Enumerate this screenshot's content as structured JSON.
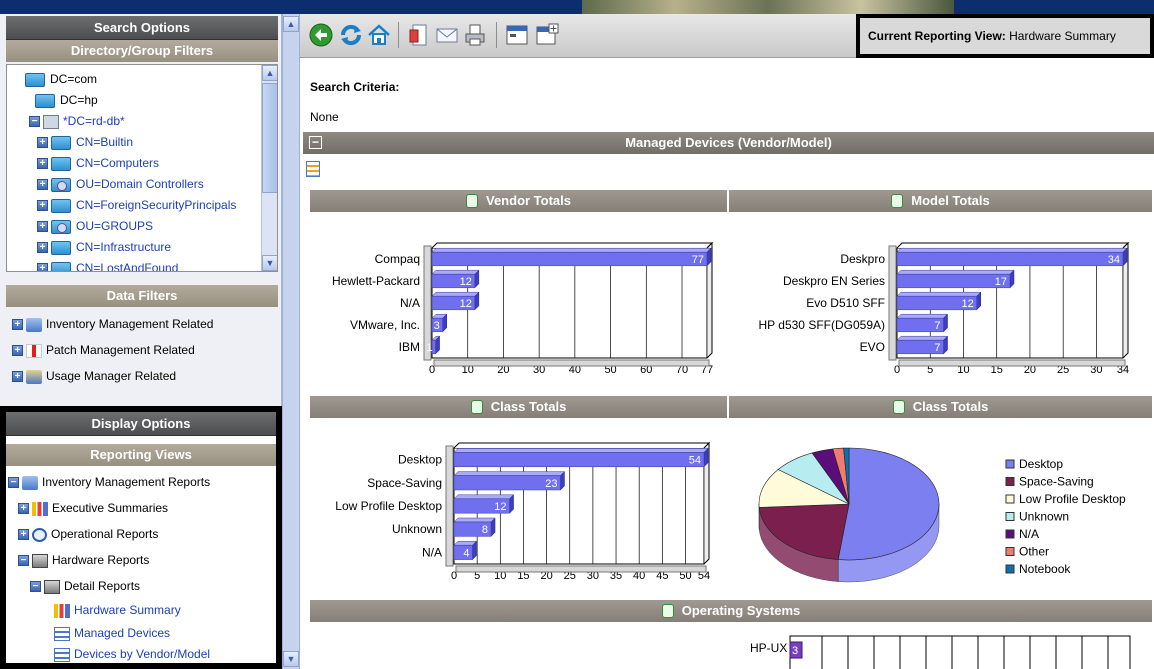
{
  "left": {
    "search_options": "Search Options",
    "directory_filters": "Directory/Group Filters",
    "tree": [
      {
        "label": "DC=com",
        "level": 0
      },
      {
        "label": "DC=hp",
        "level": 1
      },
      {
        "label": "*DC=rd-db*",
        "level": 1
      },
      {
        "label": "CN=Builtin",
        "level": 2
      },
      {
        "label": "CN=Computers",
        "level": 2
      },
      {
        "label": "OU=Domain Controllers",
        "level": 2
      },
      {
        "label": "CN=ForeignSecurityPrincipals",
        "level": 2
      },
      {
        "label": "OU=GROUPS",
        "level": 2
      },
      {
        "label": "CN=Infrastructure",
        "level": 2
      },
      {
        "label": "CN=LostAndFound",
        "level": 2
      }
    ],
    "data_filters": "Data Filters",
    "filters": [
      "Inventory Management Related",
      "Patch Management Related",
      "Usage Manager Related"
    ],
    "display_options": "Display Options",
    "reporting_views": "Reporting Views",
    "views": [
      "Inventory Management Reports",
      "Executive Summaries",
      "Operational Reports",
      "Hardware Reports",
      "Detail Reports",
      "Hardware Summary",
      "Managed Devices",
      "Devices by Vendor/Model"
    ]
  },
  "toolbar": {
    "icons": [
      "back-icon",
      "refresh-icon",
      "home-icon",
      "export-icon",
      "email-icon",
      "print-icon",
      "window-icon",
      "new-window-icon"
    ],
    "current_view_label": "Current Reporting View:",
    "current_view_value": "Hardware Summary"
  },
  "main": {
    "search_criteria_label": "Search Criteria:",
    "search_criteria_value": "None",
    "section_title": "Managed Devices (Vendor/Model)",
    "collapse_symbol": "−",
    "os_title": "Operating Systems",
    "os_partial_label": "HP-UX",
    "os_partial_value": "3"
  },
  "colors": {
    "bar": "#6f6ff0",
    "legend": [
      "#7b7ff0",
      "#7a1f4e",
      "#fffbd9",
      "#b7ecf0",
      "#5b0d79",
      "#f07c6f",
      "#0f6fae"
    ]
  },
  "chart_data": [
    {
      "type": "bar",
      "title": "Vendor Totals",
      "categories": [
        "Compaq",
        "Hewlett-Packard",
        "N/A",
        "VMware, Inc.",
        "IBM"
      ],
      "values": [
        77,
        12,
        12,
        3,
        1
      ],
      "xticks": [
        "0",
        "10",
        "20",
        "30",
        "40",
        "50",
        "60",
        "70",
        "77"
      ],
      "xlim": [
        0,
        77
      ]
    },
    {
      "type": "bar",
      "title": "Model Totals",
      "categories": [
        "Deskpro",
        "Deskpro EN Series",
        "Evo D510 SFF",
        "HP d530 SFF(DG059A)",
        "EVO"
      ],
      "values": [
        34,
        17,
        12,
        7,
        7
      ],
      "xticks": [
        "0",
        "5",
        "10",
        "15",
        "20",
        "25",
        "30",
        "34"
      ],
      "xlim": [
        0,
        34
      ]
    },
    {
      "type": "bar",
      "title": "Class Totals",
      "categories": [
        "Desktop",
        "Space-Saving",
        "Low Profile Desktop",
        "Unknown",
        "N/A"
      ],
      "values": [
        54,
        23,
        12,
        8,
        4
      ],
      "xticks": [
        "0",
        "5",
        "10",
        "15",
        "20",
        "25",
        "30",
        "35",
        "40",
        "45",
        "50",
        "54"
      ],
      "xlim": [
        0,
        54
      ]
    },
    {
      "type": "pie",
      "title": "Class Totals",
      "categories": [
        "Desktop",
        "Space-Saving",
        "Low Profile Desktop",
        "Unknown",
        "N/A",
        "Other",
        "Notebook"
      ],
      "values": [
        54,
        23,
        12,
        8,
        4,
        2,
        1
      ]
    }
  ]
}
